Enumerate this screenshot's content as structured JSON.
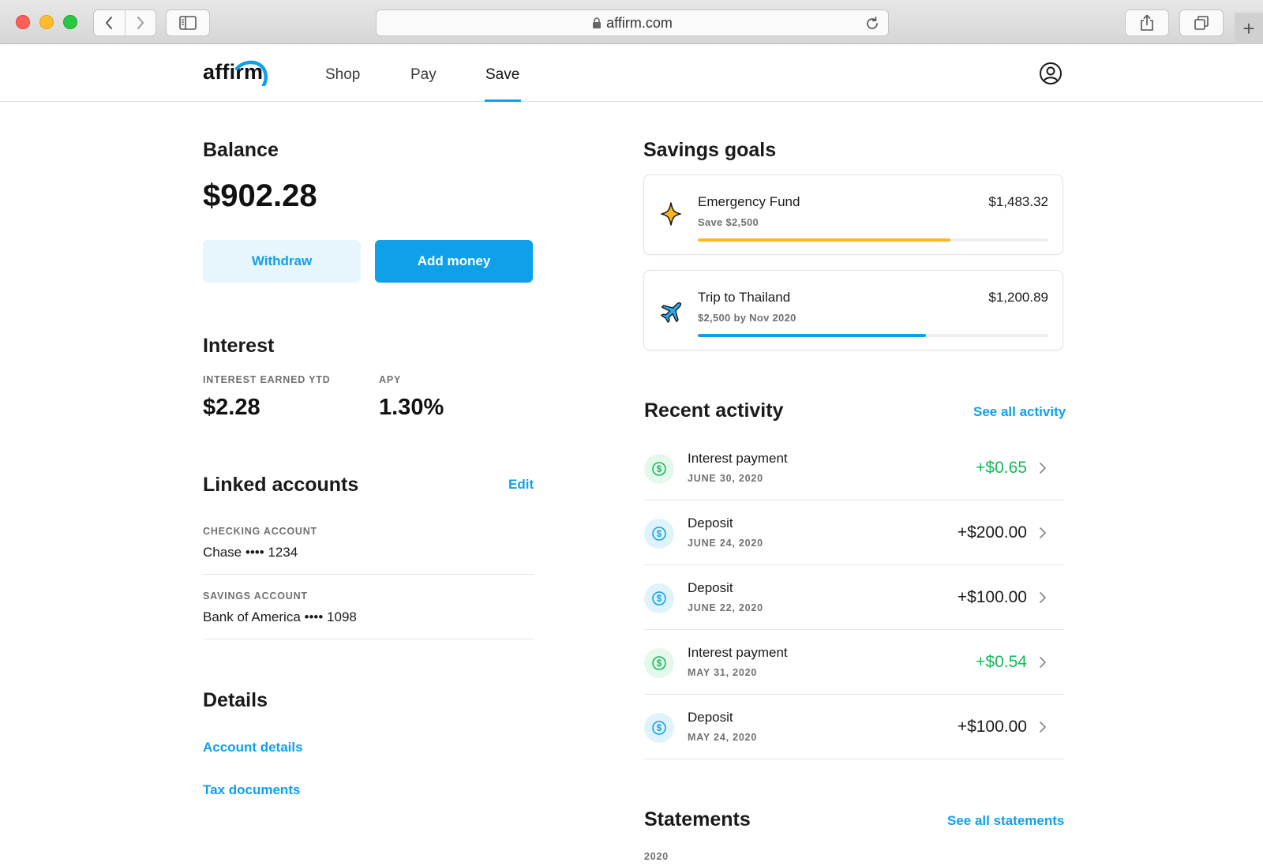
{
  "browser": {
    "url": "affirm.com"
  },
  "header": {
    "logo": "affirm",
    "tabs": [
      {
        "label": "Shop"
      },
      {
        "label": "Pay"
      },
      {
        "label": "Save"
      }
    ],
    "active_tab": "Save",
    "accent": "#0fa0ea"
  },
  "balance": {
    "title": "Balance",
    "amount": "$902.28",
    "withdraw_label": "Withdraw",
    "add_money_label": "Add money"
  },
  "interest": {
    "title": "Interest",
    "ytd_label": "INTEREST EARNED YTD",
    "ytd_value": "$2.28",
    "apy_label": "APY",
    "apy_value": "1.30%"
  },
  "linked_accounts": {
    "title": "Linked accounts",
    "edit_label": "Edit",
    "accounts": [
      {
        "type": "CHECKING ACCOUNT",
        "name": "Chase •••• 1234"
      },
      {
        "type": "SAVINGS ACCOUNT",
        "name": "Bank of America •••• 1098"
      }
    ]
  },
  "details": {
    "title": "Details",
    "links": [
      "Account details",
      "Tax documents"
    ]
  },
  "savings_goals": {
    "title": "Savings goals",
    "goals": [
      {
        "name": "Emergency Fund",
        "subtitle": "Save $2,500",
        "amount": "$1,483.32",
        "progress": 0.72,
        "color": "#fbb81c",
        "icon": "sparkle-icon"
      },
      {
        "name": "Trip to Thailand",
        "subtitle": "$2,500 by Nov 2020",
        "amount": "$1,200.89",
        "progress": 0.65,
        "color": "#0fa0ea",
        "icon": "airplane-icon"
      }
    ]
  },
  "recent_activity": {
    "title": "Recent activity",
    "see_all_label": "See all activity",
    "items": [
      {
        "title": "Interest payment",
        "date": "JUNE 30, 2020",
        "amount": "+$0.65",
        "kind": "interest"
      },
      {
        "title": "Deposit",
        "date": "JUNE 24, 2020",
        "amount": "+$200.00",
        "kind": "deposit"
      },
      {
        "title": "Deposit",
        "date": "JUNE 22, 2020",
        "amount": "+$100.00",
        "kind": "deposit"
      },
      {
        "title": "Interest payment",
        "date": "MAY 31, 2020",
        "amount": "+$0.54",
        "kind": "interest"
      },
      {
        "title": "Deposit",
        "date": "MAY 24, 2020",
        "amount": "+$100.00",
        "kind": "deposit"
      }
    ]
  },
  "statements": {
    "title": "Statements",
    "see_all_label": "See all statements",
    "year": "2020"
  }
}
